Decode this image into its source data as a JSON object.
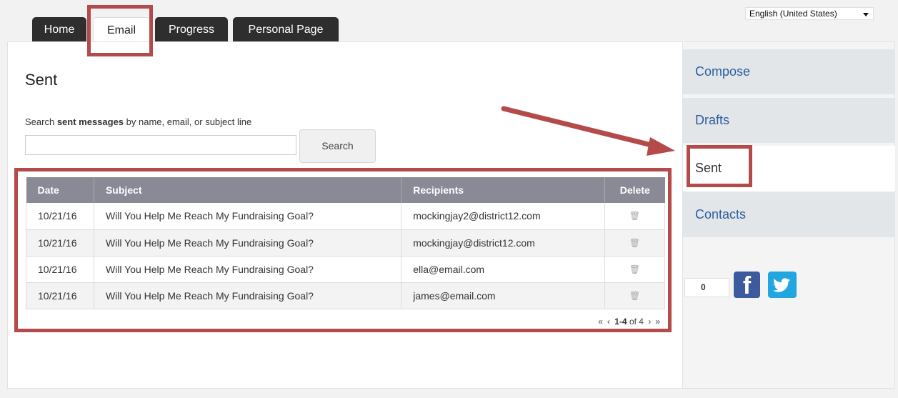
{
  "header": {
    "language": "English (United States)"
  },
  "tabs": [
    {
      "label": "Home"
    },
    {
      "label": "Email"
    },
    {
      "label": "Progress"
    },
    {
      "label": "Personal Page"
    }
  ],
  "main": {
    "title": "Sent",
    "search": {
      "label_prefix": "Search ",
      "label_bold": "sent messages",
      "label_suffix": " by name, email, or subject line",
      "value": "",
      "placeholder": "",
      "button": "Search"
    },
    "table": {
      "columns": [
        "Date",
        "Subject",
        "Recipients",
        "Delete"
      ],
      "rows": [
        {
          "date": "10/21/16",
          "subject": "Will You Help Me Reach My Fundraising Goal?",
          "recipients": "mockingjay2@district12.com"
        },
        {
          "date": "10/21/16",
          "subject": "Will You Help Me Reach My Fundraising Goal?",
          "recipients": "mockingjay@district12.com"
        },
        {
          "date": "10/21/16",
          "subject": "Will You Help Me Reach My Fundraising Goal?",
          "recipients": "ella@email.com"
        },
        {
          "date": "10/21/16",
          "subject": "Will You Help Me Reach My Fundraising Goal?",
          "recipients": "james@email.com"
        }
      ]
    },
    "pager": {
      "first": "«",
      "prev": "‹",
      "range": "1-4",
      "of_text": "of 4",
      "next": "›",
      "last": "»"
    }
  },
  "sidebar": {
    "items": [
      {
        "label": "Compose"
      },
      {
        "label": "Drafts"
      },
      {
        "label": "Sent"
      },
      {
        "label": "Contacts"
      }
    ],
    "share_count": "0",
    "facebook_icon": "f"
  },
  "colors": {
    "annotation": "#b44a4a",
    "tab_dark": "#2e2e2e",
    "link_blue": "#2b5fa0",
    "table_header": "#8a8a96",
    "facebook": "#3b5b9c",
    "twitter": "#22a6df"
  }
}
